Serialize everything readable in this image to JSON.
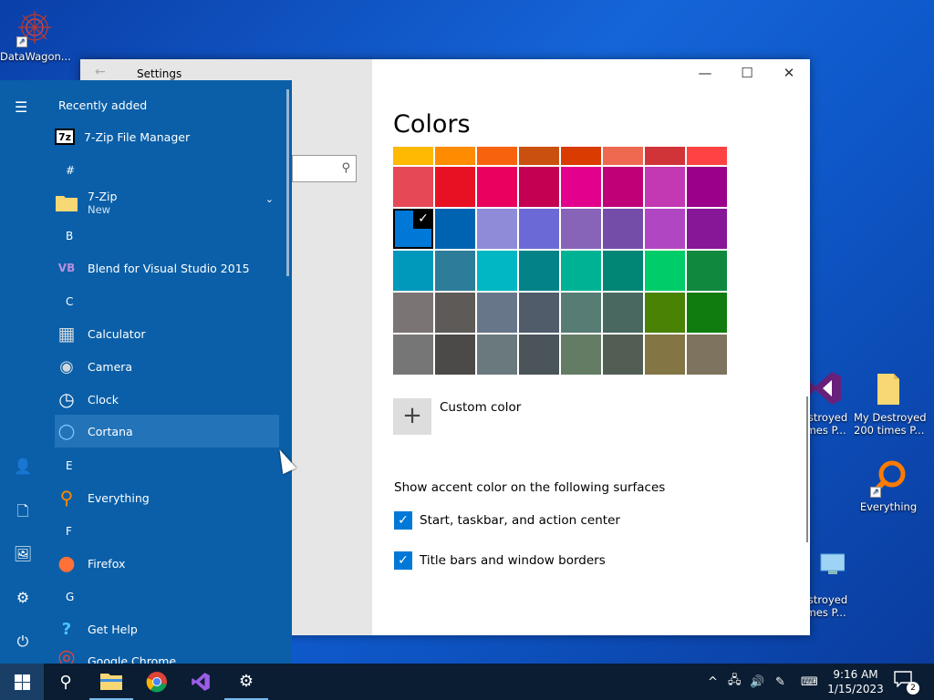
{
  "desktop": {
    "icons": [
      {
        "label": "DataWagon..."
      },
      {
        "label": "estroyed\nimes P..."
      },
      {
        "label": "My Destroyed\n200 times P..."
      },
      {
        "label": "Everything"
      },
      {
        "label": "estroyed\nimes P..."
      }
    ]
  },
  "settings": {
    "title": "Settings",
    "back_icon": "back-arrow-icon",
    "search_icon": "search-icon",
    "controls": {
      "minimize": "—",
      "maximize": "☐",
      "close": "✕"
    },
    "page_title": "Colors",
    "accent_colors": [
      [
        "#ffb900",
        "#ff8c00",
        "#f7630c",
        "#ca5010",
        "#da3b01",
        "#ef6950",
        "#d13438",
        "#ff4343"
      ],
      [
        "#e74856",
        "#e81123",
        "#ea005e",
        "#c30052",
        "#e3008c",
        "#bf0077",
        "#c239b3",
        "#9a0089"
      ],
      [
        "#0078d7",
        "#0063b1",
        "#8e8cd8",
        "#6b69d6",
        "#8764b8",
        "#744da9",
        "#b146c2",
        "#881798"
      ],
      [
        "#0099bc",
        "#2d7d9a",
        "#00b7c3",
        "#038387",
        "#00b294",
        "#018574",
        "#00cc6a",
        "#10893e"
      ],
      [
        "#7a7574",
        "#5d5a58",
        "#68768a",
        "#515c6b",
        "#567c73",
        "#486860",
        "#498205",
        "#107c10"
      ],
      [
        "#767676",
        "#4c4a48",
        "#69797e",
        "#4a5459",
        "#647c64",
        "#525e54",
        "#847545",
        "#7e735f"
      ]
    ],
    "selected_color": "#0078d7",
    "checkmark": "✓",
    "custom_color_label": "Custom color",
    "custom_color_glyph": "+",
    "surfaces_label": "Show accent color on the following surfaces",
    "checkboxes": [
      {
        "label": "Start, taskbar, and action center",
        "checked": true
      },
      {
        "label": "Title bars and window borders",
        "checked": true
      }
    ]
  },
  "start_menu": {
    "recently_added": "Recently added",
    "hamburger": "☰",
    "items": [
      {
        "label": "7-Zip File Manager",
        "icon": "7z"
      },
      {
        "letter": "#"
      },
      {
        "label": "7-Zip",
        "sub": "New",
        "icon": "folder"
      },
      {
        "letter": "B"
      },
      {
        "label": "Blend for Visual Studio 2015",
        "icon": "VB"
      },
      {
        "letter": "C"
      },
      {
        "label": "Calculator",
        "icon": "▦"
      },
      {
        "label": "Camera",
        "icon": "◉"
      },
      {
        "label": "Clock",
        "icon": "◷"
      },
      {
        "label": "Cortana",
        "icon": "○"
      },
      {
        "letter": "E"
      },
      {
        "label": "Everything",
        "icon": "⚲"
      },
      {
        "letter": "F"
      },
      {
        "label": "Firefox",
        "icon": "●"
      },
      {
        "letter": "G"
      },
      {
        "label": "Get Help",
        "icon": "?"
      },
      {
        "label": "Google Chrome",
        "icon": "◎"
      }
    ],
    "rail": [
      "👤",
      "🗋",
      "🖼",
      "⚙",
      "⏻"
    ]
  },
  "taskbar": {
    "start_icon": "windows-logo",
    "search_glyph": "⚲",
    "apps": [
      "file-explorer",
      "chrome",
      "visual-studio",
      "settings"
    ],
    "tray_glyphs": [
      "^",
      "🖧",
      "🔊",
      "✎",
      "⌨"
    ],
    "time": "9:16 AM",
    "date": "1/15/2023",
    "notification_count": "2"
  }
}
